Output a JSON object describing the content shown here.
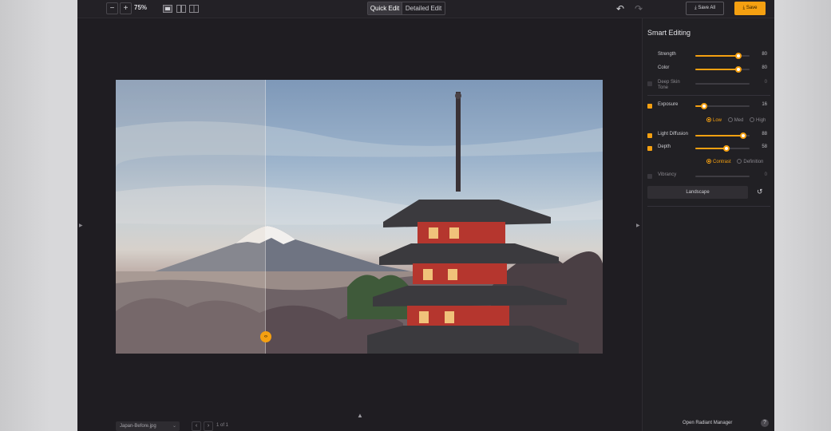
{
  "toolbar": {
    "zoom_out": "−",
    "zoom_in": "+",
    "zoom_level": "75%",
    "view_icons": [
      "single-view-icon",
      "side-by-side-view-icon",
      "split-view-icon"
    ],
    "tabs": [
      {
        "label": "Quick Edit",
        "active": true
      },
      {
        "label": "Detailed Edit",
        "active": false
      }
    ],
    "undo": "↶",
    "redo": "↷",
    "save_all_label": "⤓ Save All",
    "save_label": "⤓ Save"
  },
  "canvas": {
    "image_name": "Japan-Before.jpg",
    "page_info": "1 of 1",
    "prev": "‹",
    "next": "›",
    "split_handle": "‹›",
    "up_arrow": "▲"
  },
  "panel": {
    "title": "Smart Editing",
    "sliders": [
      {
        "label": "Strength",
        "value": "80",
        "level": 0.8,
        "checkbox": null,
        "enabled": true
      },
      {
        "label": "Color",
        "value": "80",
        "level": 0.8,
        "checkbox": null,
        "enabled": true
      },
      {
        "label": "Deep Skin Tone",
        "value": "0",
        "level": 0,
        "checkbox": "off",
        "enabled": false
      },
      {
        "label": "Exposure",
        "value": "16",
        "level": 0.16,
        "checkbox": "on",
        "enabled": true
      },
      {
        "label": "Light Diffusion",
        "value": "88",
        "level": 0.88,
        "checkbox": "on",
        "enabled": true
      },
      {
        "label": "Depth",
        "value": "58",
        "level": 0.58,
        "checkbox": "on",
        "enabled": true
      },
      {
        "label": "Vibrancy",
        "value": "0",
        "level": 0,
        "checkbox": "off",
        "enabled": false
      }
    ],
    "exposure_modes": [
      {
        "label": "Low",
        "selected": true
      },
      {
        "label": "Med",
        "selected": false
      },
      {
        "label": "High",
        "selected": false
      }
    ],
    "depth_modes": [
      {
        "label": "Contrast",
        "selected": true
      },
      {
        "label": "Definition",
        "selected": false
      }
    ],
    "preset_label": "Landscape",
    "footer_link": "Open Radiant Manager",
    "help": "?"
  },
  "colors": {
    "accent": "#f5a011",
    "app_bg": "#1f1d22",
    "panel_bg": "#212024"
  }
}
